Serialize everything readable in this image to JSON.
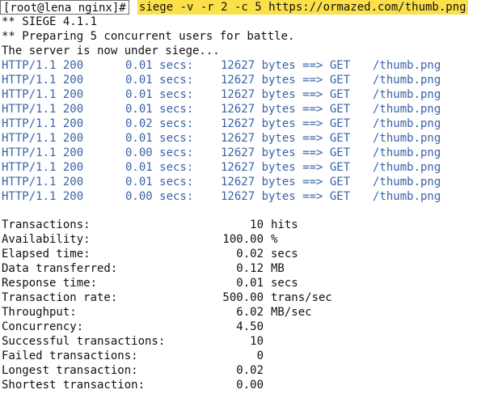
{
  "prompt": "[root@lena nginx]#",
  "command": "siege -v -r 2 -c 5 https://ormazed.com/thumb.png",
  "header_lines": [
    "** SIEGE 4.1.1",
    "** Preparing 5 concurrent users for battle.",
    "The server is now under siege..."
  ],
  "requests": [
    {
      "proto": "HTTP/1.1 200",
      "time": "0.01 secs:",
      "bytes": "12627 bytes ==> GET",
      "path": "/thumb.png"
    },
    {
      "proto": "HTTP/1.1 200",
      "time": "0.01 secs:",
      "bytes": "12627 bytes ==> GET",
      "path": "/thumb.png"
    },
    {
      "proto": "HTTP/1.1 200",
      "time": "0.01 secs:",
      "bytes": "12627 bytes ==> GET",
      "path": "/thumb.png"
    },
    {
      "proto": "HTTP/1.1 200",
      "time": "0.01 secs:",
      "bytes": "12627 bytes ==> GET",
      "path": "/thumb.png"
    },
    {
      "proto": "HTTP/1.1 200",
      "time": "0.02 secs:",
      "bytes": "12627 bytes ==> GET",
      "path": "/thumb.png"
    },
    {
      "proto": "HTTP/1.1 200",
      "time": "0.01 secs:",
      "bytes": "12627 bytes ==> GET",
      "path": "/thumb.png"
    },
    {
      "proto": "HTTP/1.1 200",
      "time": "0.00 secs:",
      "bytes": "12627 bytes ==> GET",
      "path": "/thumb.png"
    },
    {
      "proto": "HTTP/1.1 200",
      "time": "0.01 secs:",
      "bytes": "12627 bytes ==> GET",
      "path": "/thumb.png"
    },
    {
      "proto": "HTTP/1.1 200",
      "time": "0.01 secs:",
      "bytes": "12627 bytes ==> GET",
      "path": "/thumb.png"
    },
    {
      "proto": "HTTP/1.1 200",
      "time": "0.00 secs:",
      "bytes": "12627 bytes ==> GET",
      "path": "/thumb.png"
    }
  ],
  "stats": [
    {
      "label": "Transactions:",
      "value": "10",
      "unit": "hits"
    },
    {
      "label": "Availability:",
      "value": "100.00",
      "unit": "%"
    },
    {
      "label": "Elapsed time:",
      "value": "0.02",
      "unit": "secs"
    },
    {
      "label": "Data transferred:",
      "value": "0.12",
      "unit": "MB"
    },
    {
      "label": "Response time:",
      "value": "0.01",
      "unit": "secs"
    },
    {
      "label": "Transaction rate:",
      "value": "500.00",
      "unit": "trans/sec"
    },
    {
      "label": "Throughput:",
      "value": "6.02",
      "unit": "MB/sec"
    },
    {
      "label": "Concurrency:",
      "value": "4.50",
      "unit": ""
    },
    {
      "label": "Successful transactions:",
      "value": "10",
      "unit": ""
    },
    {
      "label": "Failed transactions:",
      "value": "0",
      "unit": ""
    },
    {
      "label": "Longest transaction:",
      "value": "0.02",
      "unit": ""
    },
    {
      "label": "Shortest transaction:",
      "value": "0.00",
      "unit": ""
    }
  ],
  "colors": {
    "http_text": "#3a63a8",
    "highlight": "#fbe04a"
  }
}
